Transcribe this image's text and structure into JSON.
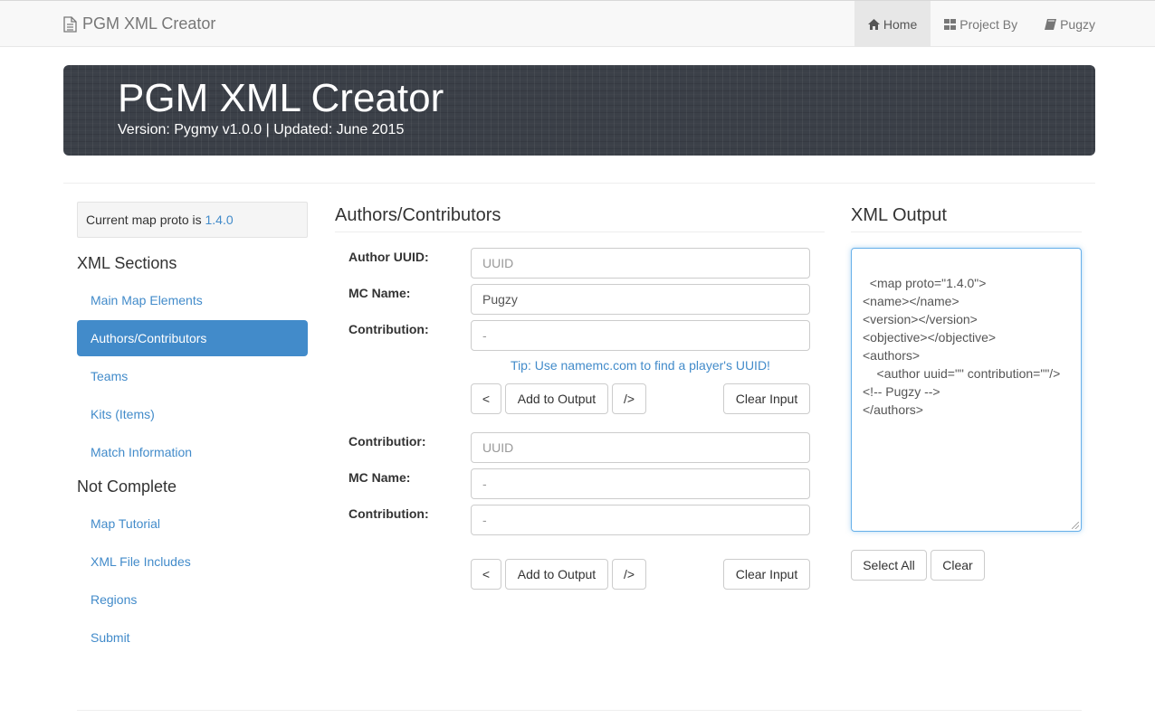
{
  "navbar": {
    "brand": "PGM XML Creator",
    "brand_icon": "file-icon",
    "items": [
      {
        "label": "Home",
        "icon": "home-icon"
      },
      {
        "label": "Project By",
        "icon": "grid-icon"
      },
      {
        "label": "Pugzy",
        "icon": "book-icon"
      }
    ]
  },
  "jumbotron": {
    "title": "PGM XML Creator",
    "version": "Version: Pygmy v1.0.0 | Updated: June 2015"
  },
  "sidebar": {
    "proto_prefix": "Current map proto is ",
    "proto_version": "1.4.0",
    "sections_heading": "XML Sections",
    "sections": [
      {
        "label": "Main Map Elements"
      },
      {
        "label": "Authors/Contributors"
      },
      {
        "label": "Teams"
      },
      {
        "label": "Kits (Items)"
      },
      {
        "label": "Match Information"
      }
    ],
    "incomplete_heading": "Not Complete",
    "incomplete": [
      {
        "label": "Map Tutorial"
      },
      {
        "label": "XML File Includes"
      },
      {
        "label": "Regions"
      },
      {
        "label": "Submit"
      }
    ]
  },
  "authors_form": {
    "title": "Authors/Contributors",
    "author": {
      "uuid_label": "Author UUID:",
      "uuid_placeholder": "UUID",
      "uuid_value": "",
      "name_label": "MC Name:",
      "name_value": "Pugzy",
      "contribution_label": "Contribution:",
      "contribution_placeholder": "-",
      "contribution_value": ""
    },
    "tip": "Tip: Use namemc.com to find a player's UUID!",
    "contributor": {
      "uuid_label": "Contributior:",
      "uuid_placeholder": "UUID",
      "uuid_value": "",
      "name_label": "MC Name:",
      "name_placeholder": "-",
      "name_value": "",
      "contribution_label": "Contribution:",
      "contribution_placeholder": "-",
      "contribution_value": ""
    },
    "buttons": {
      "open": "<",
      "add": "Add to Output",
      "close": "/>",
      "clear": "Clear Input"
    }
  },
  "output": {
    "title": "XML Output",
    "text": "<map proto=\"1.4.0\">\n<name></name>\n<version></version>\n<objective></objective>\n<authors>\n    <author uuid=\"\" contribution=\"\"/>\n<!-- Pugzy -->\n</authors>",
    "select_all": "Select All",
    "clear": "Clear"
  },
  "colors": {
    "link": "#428bca",
    "active_bg": "#428bca",
    "jumbotron_bg": "#3b4048"
  }
}
